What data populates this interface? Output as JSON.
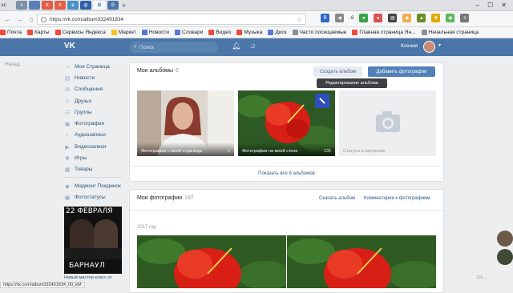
{
  "browser": {
    "first_tab": "кс",
    "tab_icons": [
      "x",
      "К",
      "К",
      "в",
      "ф",
      "В",
      "В"
    ],
    "window_controls": [
      "–",
      "☐",
      "✕"
    ],
    "url": "https://vk.com/album332491834",
    "ext_badge": "-6"
  },
  "bookmarks": [
    {
      "label": "Почта",
      "color": "#f04a3b"
    },
    {
      "label": "Карты",
      "color": "#f04a3b"
    },
    {
      "label": "Сервисы Яндекса",
      "color": "#f04a3b"
    },
    {
      "label": "Маркет",
      "color": "#f8c21c"
    },
    {
      "label": "Новости",
      "color": "#4f7bd6"
    },
    {
      "label": "Словари",
      "color": "#4f7bd6"
    },
    {
      "label": "Видео",
      "color": "#f04a3b"
    },
    {
      "label": "Музыка",
      "color": "#f04a3b"
    },
    {
      "label": "Диск",
      "color": "#4f7bd6"
    },
    {
      "label": "Часто посещаемые",
      "color": "#8a8f96"
    },
    {
      "label": "Главная страница Ян...",
      "color": "#f04a3b"
    },
    {
      "label": "Начальная страница",
      "color": "#8a8f96"
    }
  ],
  "header": {
    "search_placeholder": "Поиск",
    "user_name": "Ксения"
  },
  "sidebar": {
    "back_label": "Назад",
    "items": [
      {
        "label": "Моя Страница",
        "icon": "home-icon",
        "glyph": "⌂"
      },
      {
        "label": "Новости",
        "icon": "news-icon",
        "glyph": "▤"
      },
      {
        "label": "Сообщения",
        "icon": "messages-icon",
        "glyph": "✉"
      },
      {
        "label": "Друзья",
        "icon": "friends-icon",
        "glyph": "☺"
      },
      {
        "label": "Группы",
        "icon": "groups-icon",
        "glyph": "☷"
      },
      {
        "label": "Фотографии",
        "icon": "photos-icon",
        "glyph": "▣"
      },
      {
        "label": "Аудиозаписи",
        "icon": "audio-icon",
        "glyph": "♪"
      },
      {
        "label": "Видеозаписи",
        "icon": "video-icon",
        "glyph": "▶"
      },
      {
        "label": "Игры",
        "icon": "games-icon",
        "glyph": "✚"
      },
      {
        "label": "Товары",
        "icon": "goods-icon",
        "glyph": "▦"
      }
    ],
    "extra_items": [
      {
        "label": "Маджонг Поединок",
        "icon": "game-app-icon",
        "glyph": "◆"
      },
      {
        "label": "Фотостатусы",
        "icon": "photostatus-icon",
        "glyph": "▣"
      }
    ],
    "ad": {
      "date": "22 ФЕВРАЛЯ",
      "city": "БАРНАУЛ",
      "caption": "Новый мастер-класс от"
    }
  },
  "albums_panel": {
    "title": "Мои альбомы",
    "count": "6",
    "create_button": "Создать альбом",
    "add_button": "Добавить фотографии",
    "tooltip": "Редактирование альбома",
    "albums": [
      {
        "title": "Фотографии с моей страницы",
        "count": "3"
      },
      {
        "title": "Фотографии на моей стене",
        "count": "135"
      },
      {
        "title": "Статусы в картинках",
        "count": ""
      }
    ],
    "show_all": "Показать все 6 альбомов"
  },
  "photos_panel": {
    "title": "Мои фотографии",
    "count": "197",
    "download_link": "Скачать альбом",
    "comments_link": "Комментарии к фотографиям",
    "year": "2017 год"
  },
  "status_bar": {
    "url": "https://vk.com/album332491834_00_kM"
  },
  "right_strip": {
    "tag": "136 ..."
  }
}
